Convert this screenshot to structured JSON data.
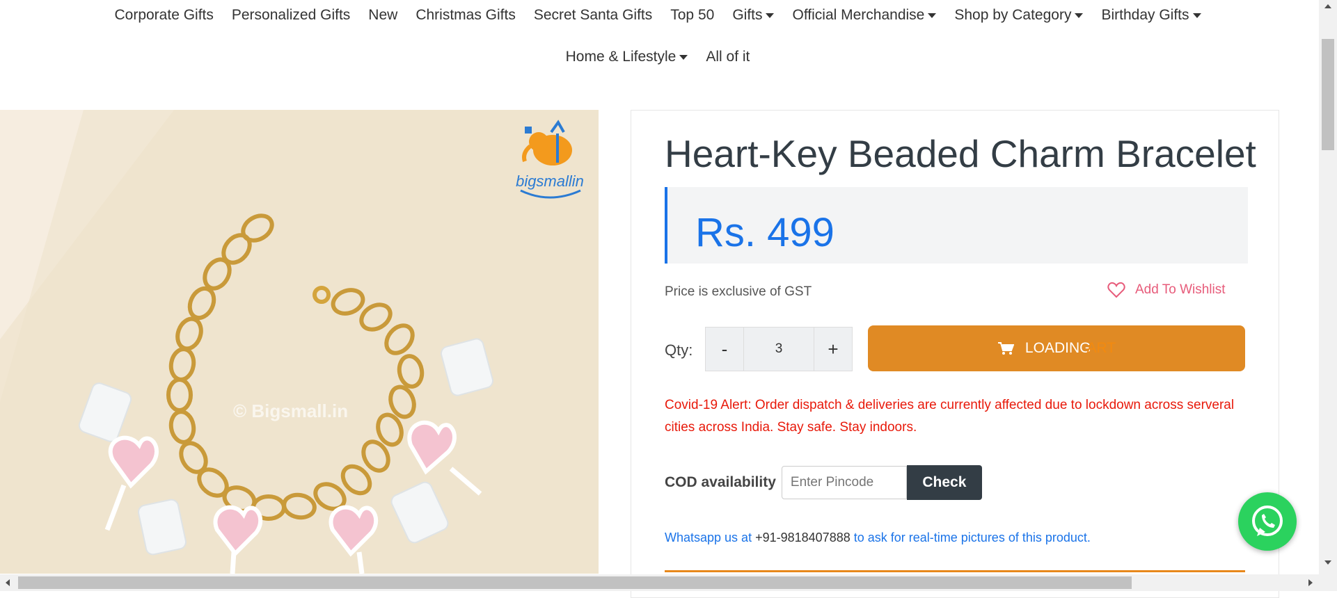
{
  "nav": {
    "row1": [
      {
        "label": "Corporate Gifts",
        "dropdown": false
      },
      {
        "label": "Personalized Gifts",
        "dropdown": false
      },
      {
        "label": "New",
        "dropdown": false
      },
      {
        "label": "Christmas Gifts",
        "dropdown": false
      },
      {
        "label": "Secret Santa Gifts",
        "dropdown": false
      },
      {
        "label": "Top 50",
        "dropdown": false
      },
      {
        "label": "Gifts",
        "dropdown": true
      },
      {
        "label": "Official Merchandise",
        "dropdown": true
      },
      {
        "label": "Shop by Category",
        "dropdown": true
      },
      {
        "label": "Birthday Gifts",
        "dropdown": true
      }
    ],
    "row2": [
      {
        "label": "Home & Lifestyle",
        "dropdown": true
      },
      {
        "label": "All of it",
        "dropdown": false
      }
    ]
  },
  "image": {
    "watermark": "© Bigsmall.in",
    "logo_text": "bigsmallin"
  },
  "product": {
    "title": "Heart-Key Beaded Charm Bracelet",
    "price": "Rs. 499",
    "gst_note": "Price is exclusive of GST",
    "wishlist_label": "Add To Wishlist",
    "qty_label": "Qty:",
    "qty_minus": "-",
    "qty_value": "3",
    "qty_plus": "+",
    "cart_button_label": "LOADING",
    "cart_button_faded": "ART",
    "covid_alert": "Covid-19 Alert: Order dispatch & deliveries are currently affected due to lockdown across serveral cities across India. Stay safe. Stay indoors.",
    "cod_label": "COD availability",
    "pincode_placeholder": "Enter Pincode",
    "check_label": "Check",
    "whatsapp_prefix": "Whatsapp us at",
    "whatsapp_phone": "+91-9818407888",
    "whatsapp_suffix": "to ask for real-time pictures of this product."
  },
  "colors": {
    "price_blue": "#1a73e8",
    "cart_orange": "#e08a24",
    "alert_red": "#e8190a",
    "wishlist_pink": "#e75b7a",
    "whatsapp_green": "#2bd25e"
  }
}
